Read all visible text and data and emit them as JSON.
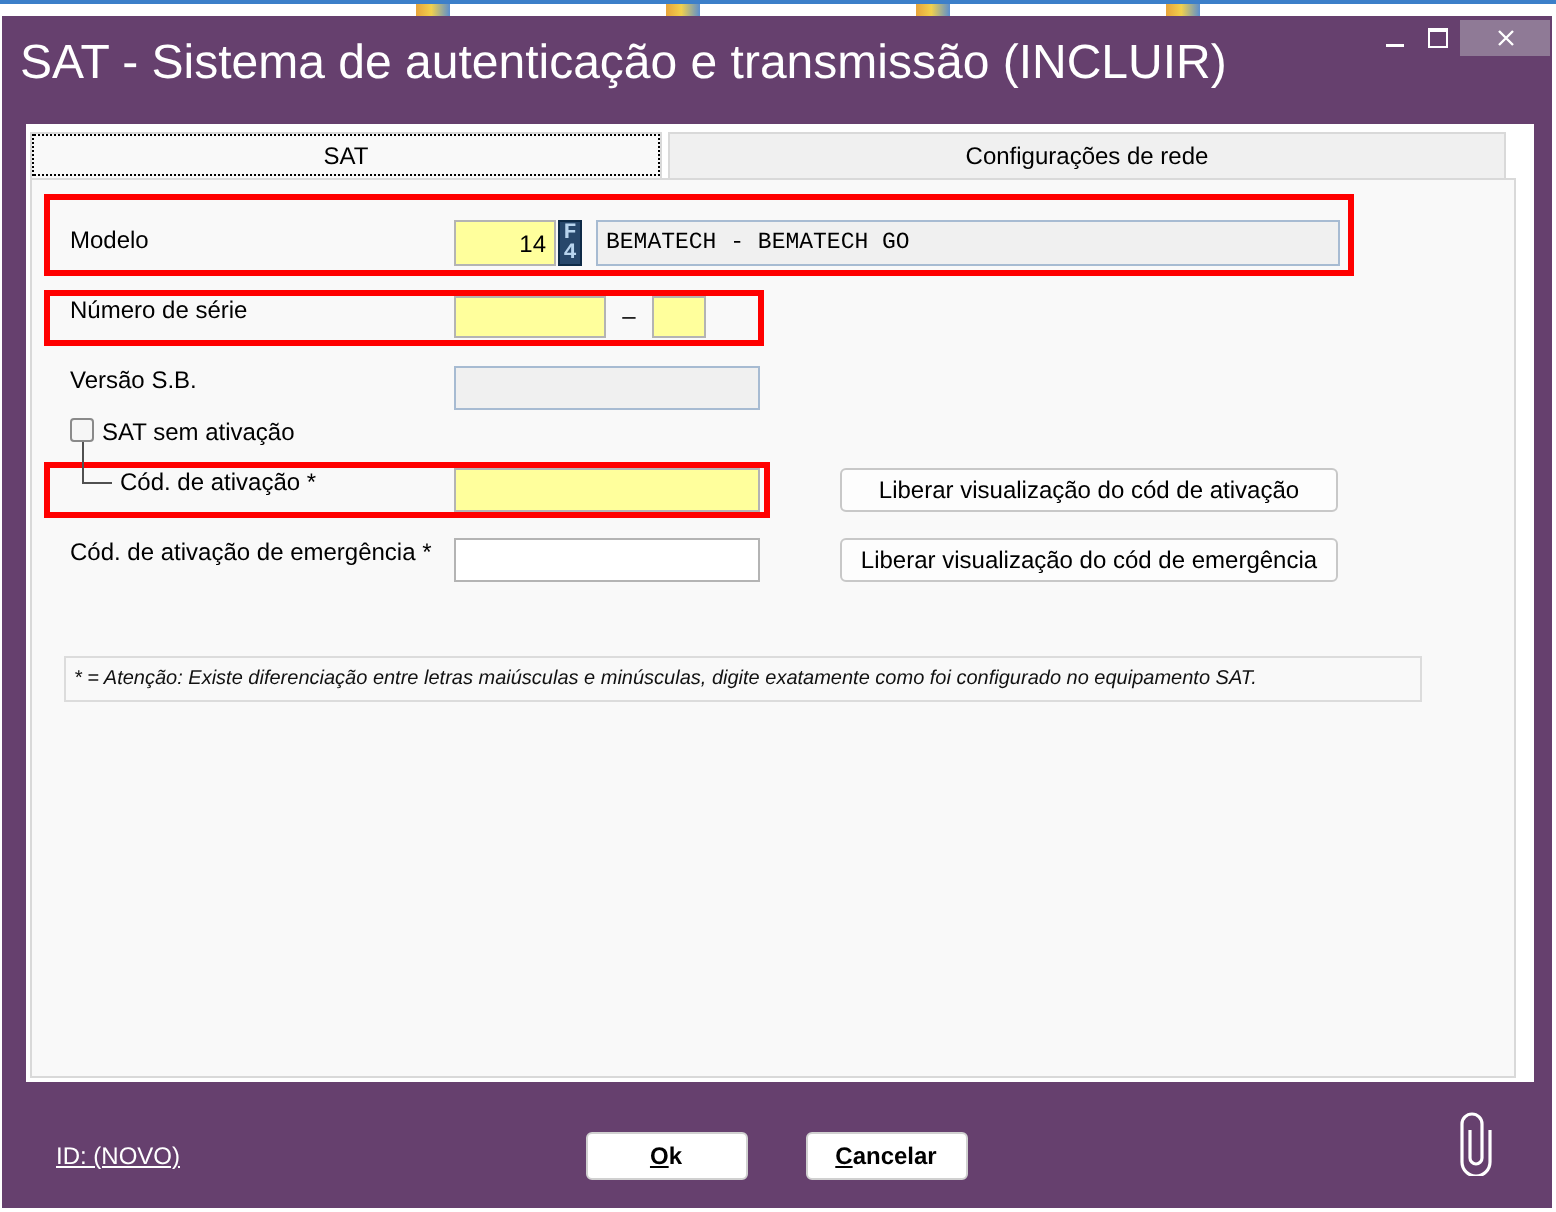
{
  "window": {
    "title": "SAT - Sistema de autenticação e transmissão (INCLUIR)"
  },
  "tabs": [
    {
      "label": "SAT",
      "selected": true
    },
    {
      "label": "Configurações de rede",
      "selected": false
    }
  ],
  "form": [
    {
      "kind": "lookup",
      "label": "Modelo",
      "highlighted": true,
      "code": {
        "value": "14",
        "required": true
      },
      "lookup_key": "F4",
      "description": {
        "value": "BEMATECH - BEMATECH GO",
        "disabled": true
      }
    },
    {
      "kind": "split",
      "label": "Número de série",
      "highlighted": true,
      "separator": "–",
      "fields": [
        {
          "required": true
        },
        {
          "required": true
        }
      ]
    },
    {
      "kind": "text",
      "label": "Versão S.B.",
      "highlighted": false,
      "field": {
        "required": false,
        "disabled": true
      }
    },
    {
      "kind": "checkbox",
      "label": "SAT sem ativação",
      "checked": false,
      "children": [
        {
          "kind": "text",
          "label": "Cód. de ativação *",
          "highlighted": true,
          "field": {
            "required": true,
            "disabled": false
          },
          "action": "Liberar visualização do cód de ativação"
        }
      ]
    },
    {
      "kind": "text",
      "label": "Cód. de ativação de emergência *",
      "highlighted": false,
      "field": {
        "required": false,
        "disabled": false
      },
      "action": "Liberar visualização do cód de emergência"
    }
  ],
  "note": "* = Atenção: Existe diferenciação entre letras maiúsculas e minúsculas, digite exatamente como foi configurado no equipamento SAT.",
  "footer": {
    "id_link": "ID: (NOVO)",
    "buttons": [
      {
        "label": "Ok"
      },
      {
        "label": "Cancelar"
      }
    ]
  }
}
